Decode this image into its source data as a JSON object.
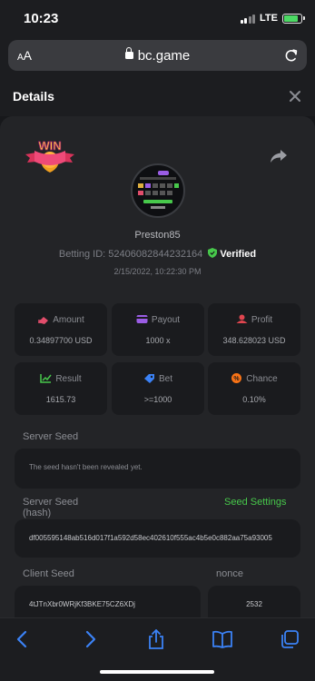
{
  "status_bar": {
    "time": "10:23",
    "network": "LTE",
    "battery_level": 0.85
  },
  "browser": {
    "text_size_label": "AA",
    "url": "bc.game"
  },
  "header": {
    "title": "Details"
  },
  "bet": {
    "badge": "WIN",
    "username": "Preston85",
    "betting_id_label": "Betting ID:",
    "betting_id": "524060828442321​64",
    "verified_label": "Verified",
    "date": "2/15/2022, 10:22:30 PM"
  },
  "stats": [
    {
      "label": "Amount",
      "value": "0.34897700 USD",
      "icon": "amount-icon",
      "color": "#e24d6b"
    },
    {
      "label": "Payout",
      "value": "1000 x",
      "icon": "payout-icon",
      "color": "#9b5de5"
    },
    {
      "label": "Profit",
      "value": "348.628023 USD",
      "icon": "profit-icon",
      "color": "#e0454f"
    },
    {
      "label": "Result",
      "value": "1615.73",
      "icon": "result-icon",
      "color": "#47c84b"
    },
    {
      "label": "Bet",
      "value": ">=1000",
      "icon": "bet-icon",
      "color": "#3b82f6"
    },
    {
      "label": "Chance",
      "value": "0.10%",
      "icon": "chance-icon",
      "color": "#f97316"
    }
  ],
  "seeds": {
    "server_seed_label": "Server Seed",
    "server_seed_value": "The seed hasn't been revealed yet.",
    "server_hash_label_1": "Server Seed",
    "server_hash_label_2": "(hash)",
    "seed_settings_link": "Seed Settings",
    "server_hash_value": "df005595148ab516d017f1a592d58ec402610f555ac4b5e0c882aa75a93005",
    "client_seed_label": "Client Seed",
    "client_seed_value": "4tJTnXbr0WRjKf3BKE75CZ6XDj",
    "nonce_label": "nonce",
    "nonce_value": "2532"
  }
}
